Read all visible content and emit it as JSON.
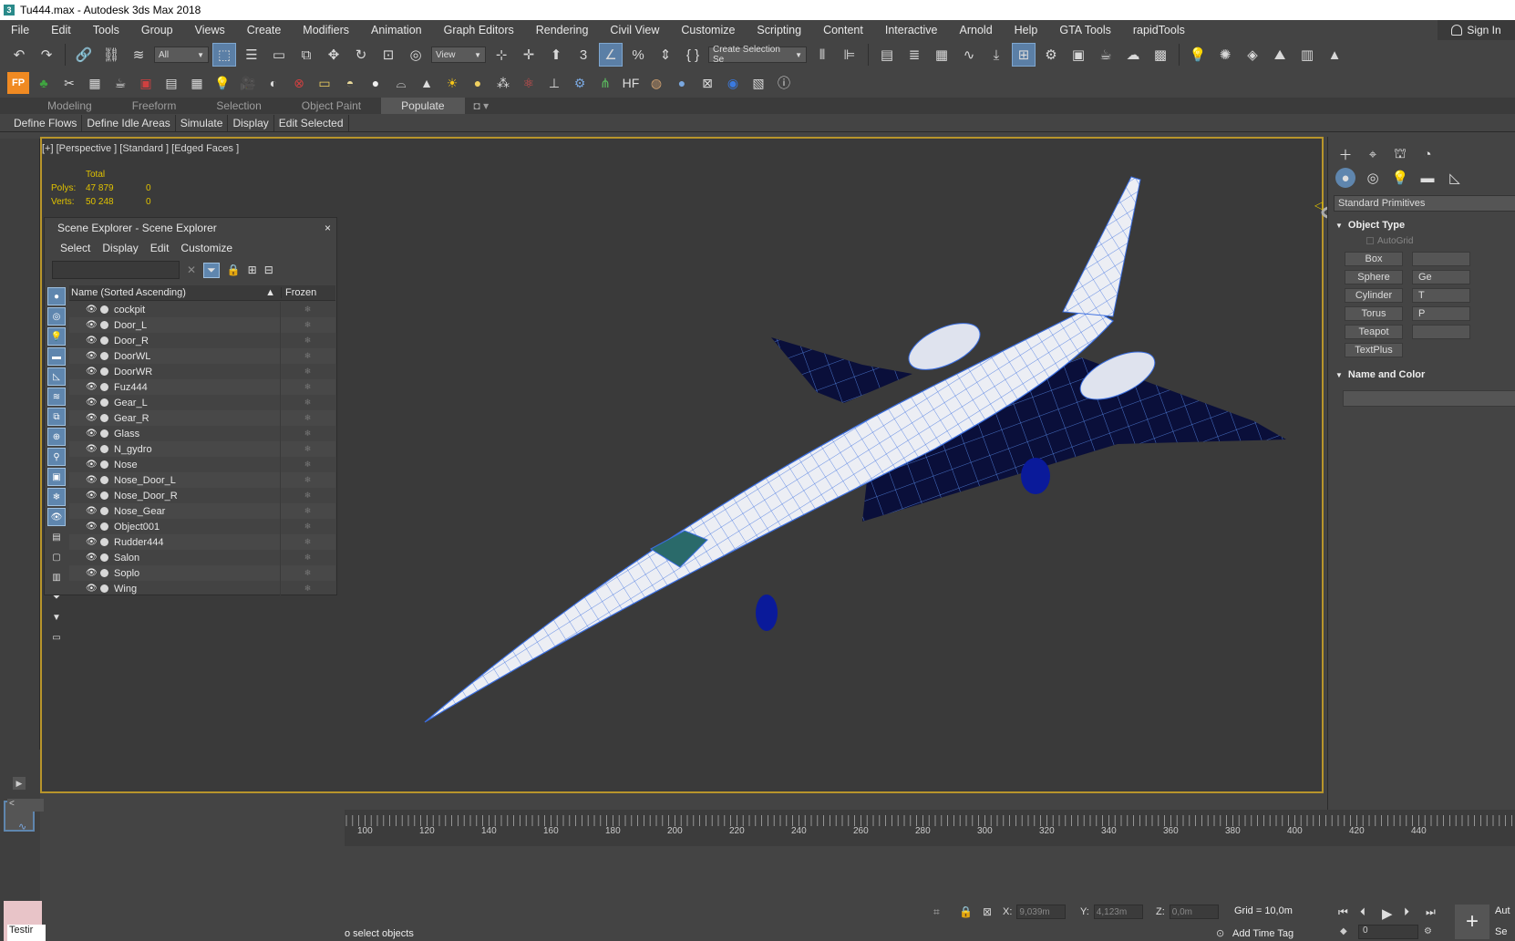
{
  "window": {
    "title": "Tu444.max - Autodesk 3ds Max 2018",
    "app_icon": "3"
  },
  "menubar": {
    "items": [
      "File",
      "Edit",
      "Tools",
      "Group",
      "Views",
      "Create",
      "Modifiers",
      "Animation",
      "Graph Editors",
      "Rendering",
      "Civil View",
      "Customize",
      "Scripting",
      "Content",
      "Interactive",
      "Arnold",
      "Help",
      "GTA Tools",
      "rapidTools"
    ],
    "signin": "Sign In"
  },
  "toolbar1": {
    "filter_value": "All",
    "refcoord_value": "View",
    "selection_set_placeholder": "Create Selection Se"
  },
  "ribbon": {
    "tabs": [
      "Modeling",
      "Freeform",
      "Selection",
      "Object Paint",
      "Populate"
    ],
    "active_tab": "Populate",
    "buttons": [
      "Define Flows",
      "Define Idle Areas",
      "Simulate",
      "Display",
      "Edit Selected"
    ]
  },
  "viewport": {
    "label": "[+] [Perspective ] [Standard ] [Edged Faces ]",
    "stats": {
      "total_label": "Total",
      "polys_label": "Polys:",
      "polys_total": "47 879",
      "polys_sel": "0",
      "verts_label": "Verts:",
      "verts_total": "50 248",
      "verts_sel": "0"
    }
  },
  "scene_explorer": {
    "title": "Scene Explorer - Scene Explorer",
    "close": "×",
    "menu": [
      "Select",
      "Display",
      "Edit",
      "Customize"
    ],
    "col_name": "Name (Sorted Ascending)",
    "col_sort": "▲",
    "col_frozen": "Frozen",
    "objects": [
      "cockpit",
      "Door_L",
      "Door_R",
      "DoorWL",
      "DoorWR",
      "Fuz444",
      "Gear_L",
      "Gear_R",
      "Glass",
      "N_gydro",
      "Nose",
      "Nose_Door_L",
      "Nose_Door_R",
      "Nose_Gear",
      "Object001",
      "Rudder444",
      "Salon",
      "Soplo",
      "Wing"
    ]
  },
  "command_panel": {
    "category": "Standard Primitives",
    "object_type": "Object Type",
    "autogrid": "AutoGrid",
    "buttons_left": [
      "Box",
      "Sphere",
      "Cylinder",
      "Torus",
      "Teapot",
      "TextPlus"
    ],
    "buttons_right": [
      "",
      "Ge",
      "T",
      "P",
      "",
      ""
    ],
    "name_and_color": "Name and Color"
  },
  "timeline": {
    "ticks": [
      "100",
      "120",
      "140",
      "160",
      "180",
      "200",
      "220",
      "240",
      "260",
      "280",
      "300",
      "320",
      "340",
      "360",
      "380",
      "400",
      "420",
      "440"
    ]
  },
  "statusbar": {
    "status_text": "o select objects",
    "x_label": "X:",
    "x_value": "9,039m",
    "y_label": "Y:",
    "y_value": "4,123m",
    "z_label": "Z:",
    "z_value": "0,0m",
    "grid": "Grid = 10,0m",
    "add_time_tag": "Add Time Tag",
    "frame": "0",
    "maxscript_text": "Testir",
    "auto_label": "Aut",
    "set_label": "Se"
  },
  "colors": {
    "viewport_border": "#b8952b",
    "active_blue": "#5b7fa6",
    "stats_yellow": "#e0c200",
    "wire_blue": "#3a6ee0"
  }
}
